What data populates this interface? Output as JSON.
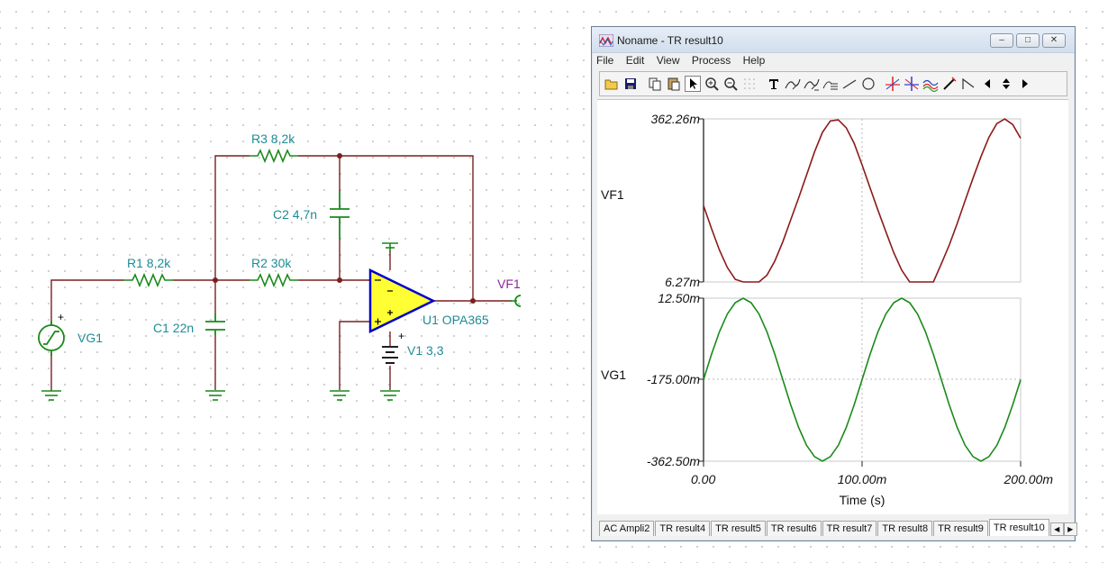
{
  "schematic": {
    "labels": {
      "r3": "R3 8,2k",
      "c2": "C2 4,7n",
      "r1": "R1 8,2k",
      "r2": "R2 30k",
      "c1": "C1 22n",
      "vg1": "VG1",
      "vf1": "VF1",
      "u1": "U1 OPA365",
      "v1": "V1 3,3",
      "plus": "+"
    },
    "colors": {
      "wire": "#7a1f1f",
      "component": "#1a8a1a",
      "label": "#1f8c95",
      "net_label": "#8a2a9c",
      "opamp_fill": "#ffff33",
      "opamp_stroke": "#0000cc"
    }
  },
  "window": {
    "title": "Noname - TR result10",
    "controls": {
      "minimize": "‒",
      "maximize": "□",
      "close": "✕"
    },
    "menu": [
      "File",
      "Edit",
      "View",
      "Process",
      "Help"
    ],
    "toolbar_icons": [
      "open-icon",
      "save-icon",
      "copy-icon",
      "paste-icon",
      "pointer-icon",
      "zoom-in-icon",
      "zoom-out-icon",
      "grid-icon",
      "text-icon",
      "curve-label-icon",
      "curve-label2-icon",
      "marker-icon",
      "line-icon",
      "circle-icon",
      "cursor-a-icon",
      "cursor-b-icon",
      "waves-icon",
      "pen-icon",
      "step-icon",
      "arrow-left-icon",
      "arrow-up-down-icon",
      "arrow-right-icon"
    ],
    "tabs": [
      "AC Ampli2",
      "TR result4",
      "TR result5",
      "TR result6",
      "TR result7",
      "TR result8",
      "TR result9",
      "TR result10"
    ],
    "active_tab": "TR result10"
  },
  "chart_data": [
    {
      "type": "line",
      "name": "VF1",
      "ylabel": "VF1",
      "ylim": [
        0.00627,
        0.36226
      ],
      "yticks": [
        "362.26m",
        "6.27m"
      ],
      "x": [
        0,
        0.005,
        0.01,
        0.015,
        0.02,
        0.025,
        0.03,
        0.035,
        0.04,
        0.045,
        0.05,
        0.055,
        0.06,
        0.065,
        0.07,
        0.075,
        0.08,
        0.085,
        0.09,
        0.095,
        0.1,
        0.105,
        0.11,
        0.115,
        0.12,
        0.125,
        0.13,
        0.135,
        0.14,
        0.145,
        0.15,
        0.155,
        0.16,
        0.165,
        0.17,
        0.175,
        0.18,
        0.185,
        0.19,
        0.195,
        0.2
      ],
      "values": [
        0.173,
        0.123,
        0.076,
        0.038,
        0.012,
        0.00627,
        0.00627,
        0.00627,
        0.021,
        0.052,
        0.094,
        0.142,
        0.19,
        0.24,
        0.29,
        0.333,
        0.358,
        0.36,
        0.343,
        0.309,
        0.262,
        0.212,
        0.163,
        0.116,
        0.07,
        0.032,
        0.00627,
        0.00627,
        0.00627,
        0.00627,
        0.046,
        0.087,
        0.134,
        0.184,
        0.233,
        0.28,
        0.322,
        0.352,
        0.362,
        0.35,
        0.32
      ],
      "color": "#8b1a1a"
    },
    {
      "type": "line",
      "name": "VG1",
      "ylabel": "VG1",
      "ylim": [
        -0.3625,
        0.0125
      ],
      "yticks": [
        "12.50m",
        "-175.00m",
        "-362.50m"
      ],
      "x": [
        0,
        0.005,
        0.01,
        0.015,
        0.02,
        0.025,
        0.03,
        0.035,
        0.04,
        0.045,
        0.05,
        0.055,
        0.06,
        0.065,
        0.07,
        0.075,
        0.08,
        0.085,
        0.09,
        0.095,
        0.1,
        0.105,
        0.11,
        0.115,
        0.12,
        0.125,
        0.13,
        0.135,
        0.14,
        0.145,
        0.15,
        0.155,
        0.16,
        0.165,
        0.17,
        0.175,
        0.18,
        0.185,
        0.19,
        0.195,
        0.2
      ],
      "values": [
        -0.175,
        -0.117,
        -0.065,
        -0.024,
        0.0021,
        0.0125,
        0.0021,
        -0.024,
        -0.065,
        -0.117,
        -0.175,
        -0.233,
        -0.285,
        -0.326,
        -0.352,
        -0.3625,
        -0.352,
        -0.326,
        -0.285,
        -0.233,
        -0.175,
        -0.117,
        -0.065,
        -0.024,
        0.0021,
        0.0125,
        0.0021,
        -0.024,
        -0.065,
        -0.117,
        -0.175,
        -0.233,
        -0.285,
        -0.326,
        -0.352,
        -0.3625,
        -0.352,
        -0.326,
        -0.285,
        -0.233,
        -0.175
      ],
      "color": "#1a8a1a"
    }
  ],
  "xaxis": {
    "xlabel": "Time (s)",
    "xlim": [
      0,
      0.2
    ],
    "xticks": [
      "0.00",
      "100.00m",
      "200.00m"
    ]
  }
}
